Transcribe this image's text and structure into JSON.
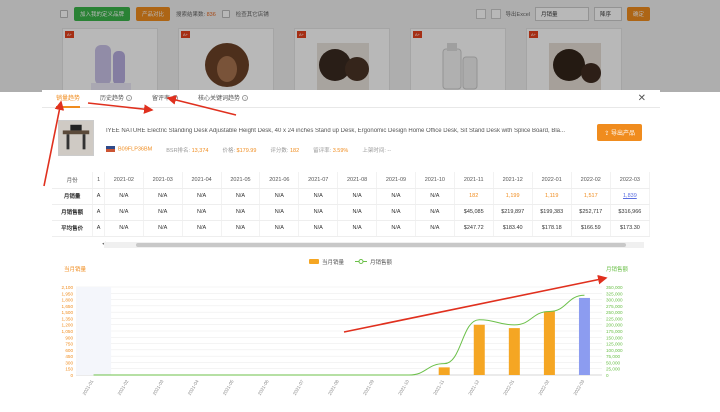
{
  "background": {
    "toolbar": {
      "btn_add": "加入我的定义品牌",
      "btn_compare": "产品对比",
      "result_label": "搜索结果数:",
      "result_count": "836",
      "same_label": "检查其它店铺",
      "export": "导出Excel",
      "sort": "月销量",
      "order": "降序",
      "confirm": "确定"
    }
  },
  "modal": {
    "tabs": [
      {
        "label": "销量趋势",
        "active": true
      },
      {
        "label": "历史趋势"
      },
      {
        "label": "留评率"
      },
      {
        "label": "核心关键词趋势"
      }
    ],
    "close": "✕",
    "product": {
      "title": "IYEE NATURE Electric Standing Desk Adjustable Height Desk, 40 x 24 inches Stand up Desk, Ergonomic Design Home Office Desk, Sit Stand Desk with Splice Board, Bla...",
      "asin": "B09FLP36BM",
      "bsr_label": "BSR排名:",
      "bsr": "13,374",
      "price_label": "价格:",
      "price": "$179.99",
      "rating_label": "评分数:",
      "rating": "182",
      "review_rate_label": "留评率:",
      "review_rate": "3.59%",
      "launch_label": "上架时间:",
      "launch": "--",
      "export_label": "导出产品"
    },
    "table": {
      "headers": [
        "月份",
        "1",
        "2021-02",
        "2021-03",
        "2021-04",
        "2021-05",
        "2021-06",
        "2021-07",
        "2021-08",
        "2021-09",
        "2021-10",
        "2021-11",
        "2021-12",
        "2022-01",
        "2022-02",
        "2022-03"
      ],
      "rows": [
        {
          "label": "月销量",
          "cells": [
            "A",
            "N/A",
            "N/A",
            "N/A",
            "N/A",
            "N/A",
            "N/A",
            "N/A",
            "N/A",
            "N/A",
            "182",
            "1,199",
            "1,119",
            "1,517",
            "1,839"
          ]
        },
        {
          "label": "月销售额",
          "cells": [
            "A",
            "N/A",
            "N/A",
            "N/A",
            "N/A",
            "N/A",
            "N/A",
            "N/A",
            "N/A",
            "N/A",
            "$45,085",
            "$219,897",
            "$199,383",
            "$252,717",
            "$316,966"
          ]
        },
        {
          "label": "平均售价",
          "cells": [
            "A",
            "N/A",
            "N/A",
            "N/A",
            "N/A",
            "N/A",
            "N/A",
            "N/A",
            "N/A",
            "N/A",
            "$247.72",
            "$183.40",
            "$178.18",
            "$166.59",
            "$173.30"
          ]
        }
      ]
    }
  },
  "chart_data": {
    "type": "bar",
    "categories": [
      "2021-01",
      "2021-02",
      "2021-03",
      "2021-04",
      "2021-05",
      "2021-06",
      "2021-07",
      "2021-08",
      "2021-09",
      "2021-10",
      "2021-11",
      "2021-12",
      "2022-01",
      "2022-02",
      "2022-03"
    ],
    "series": [
      {
        "name": "当月销量",
        "type": "bar",
        "axis": "left",
        "values": [
          0,
          0,
          0,
          0,
          0,
          0,
          0,
          0,
          0,
          0,
          182,
          1199,
          1119,
          1517,
          1839
        ],
        "color": "#f5a623",
        "last_color": "#8c9cf0"
      },
      {
        "name": "月销售额",
        "type": "line",
        "axis": "right",
        "values": [
          0,
          0,
          0,
          0,
          0,
          0,
          0,
          0,
          0,
          0,
          45085,
          219897,
          199383,
          252717,
          316966
        ],
        "color": "#6cc04a"
      }
    ],
    "ylabel_left": "当月销量",
    "ylabel_right": "月销售额",
    "ylim_left": [
      0,
      2100
    ],
    "ylim_right": [
      0,
      350000
    ],
    "yticks_left": [
      "0",
      "150",
      "300",
      "450",
      "600",
      "750",
      "900",
      "1,050",
      "1,200",
      "1,350",
      "1,500",
      "1,650",
      "1,800",
      "1,950",
      "2,100"
    ],
    "yticks_right": [
      "0",
      "25,000",
      "50,000",
      "75,000",
      "100,000",
      "125,000",
      "150,000",
      "175,000",
      "200,000",
      "225,000",
      "250,000",
      "275,000",
      "300,000",
      "325,000",
      "350,000"
    ],
    "legend": "top-center"
  },
  "colors": {
    "accent": "#f08c1e",
    "bar": "#f5a623",
    "line": "#6cc04a",
    "arrow": "#e0301e"
  }
}
